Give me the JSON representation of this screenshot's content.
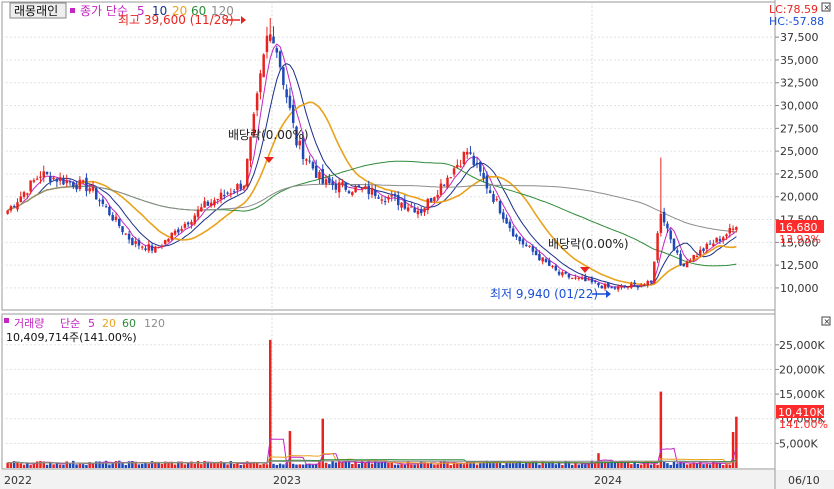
{
  "header": {
    "stock_name": "래몽래인",
    "ma_label": "종가 단순",
    "ma_periods": [
      "5",
      "10",
      "20",
      "60",
      "120"
    ],
    "lc": "LC:78.59",
    "hc": "HC:-57.88"
  },
  "volume_header": {
    "title": "거래량",
    "ma_label": "단순",
    "ma_periods": [
      "5",
      "20",
      "60",
      "120"
    ],
    "value_text": "10,409,714주(141.00%)"
  },
  "annotations": {
    "high": "최고 39,600 (11/28)",
    "low": "최저 9,940 (01/22)",
    "dividend_1": "배당락(0.00%)",
    "dividend_2": "배당락(0.00%)"
  },
  "price_tags": {
    "price": "16,680",
    "change": "13.93%"
  },
  "volume_tags": {
    "volume": "10,410K",
    "change": "141.00%"
  },
  "x_labels": [
    "2022",
    "2023",
    "2024",
    "06/10"
  ],
  "colors": {
    "up": "#e8231f",
    "down": "#1e48b8",
    "ma5": "#c326c3",
    "ma10": "#1b2f8a",
    "ma20": "#e9a21c",
    "ma60": "#2f8a3a",
    "ma120": "#8c8c8c",
    "accent_red": "#ff2a2a",
    "accent_blue": "#1a4fd6"
  },
  "chart_data": [
    {
      "type": "candlestick",
      "title": "래몽래인",
      "y_axis_ticks": [
        "37,500",
        "35,000",
        "32,500",
        "30,000",
        "27,500",
        "25,000",
        "22,500",
        "20,000",
        "17,500",
        "15,000",
        "12,500",
        "10,000"
      ],
      "ylim": [
        7800,
        39600
      ],
      "x_ticks": [
        "2022",
        "2023",
        "2024",
        "06/10"
      ],
      "series_close_keypoints": [
        {
          "x": "2022-01",
          "close": 18500
        },
        {
          "x": "2022-02",
          "close": 22500
        },
        {
          "x": "2022-04",
          "close": 21000
        },
        {
          "x": "2022-06",
          "close": 15000
        },
        {
          "x": "2022-07",
          "close": 14200
        },
        {
          "x": "2022-09",
          "close": 19000
        },
        {
          "x": "2022-11",
          "close": 21500
        },
        {
          "x": "2022-11-28",
          "close": 39600
        },
        {
          "x": "2022-12",
          "close": 26000
        },
        {
          "x": "2023-01",
          "close": 21500
        },
        {
          "x": "2023-03",
          "close": 20500
        },
        {
          "x": "2023-05",
          "close": 18500
        },
        {
          "x": "2023-07",
          "close": 25000
        },
        {
          "x": "2023-09",
          "close": 15500
        },
        {
          "x": "2023-11",
          "close": 11500
        },
        {
          "x": "2024-01-22",
          "close": 9940
        },
        {
          "x": "2024-03",
          "close": 10500
        },
        {
          "x": "2024-03-15",
          "close": 18500
        },
        {
          "x": "2024-04",
          "close": 12500
        },
        {
          "x": "2024-06-10",
          "close": 16680
        }
      ],
      "last_close": "16,680",
      "change_pct": "13.93%"
    },
    {
      "type": "bar",
      "title": "거래량",
      "y_axis_ticks": [
        "25,000K",
        "20,000K",
        "15,000K",
        "10,000K",
        "5,000K"
      ],
      "ylim": [
        0,
        28000
      ],
      "spikes_k": [
        {
          "x": "2022-11-28",
          "value": 26000
        },
        {
          "x": "2022-12",
          "value": 7500
        },
        {
          "x": "2023-01",
          "value": 10000
        },
        {
          "x": "2023-12",
          "value": 3000
        },
        {
          "x": "2024-03-15",
          "value": 15500
        },
        {
          "x": "2024-06-10",
          "value": 10410
        }
      ],
      "last_volume": "10,410K",
      "change_pct": "141.00%"
    }
  ]
}
